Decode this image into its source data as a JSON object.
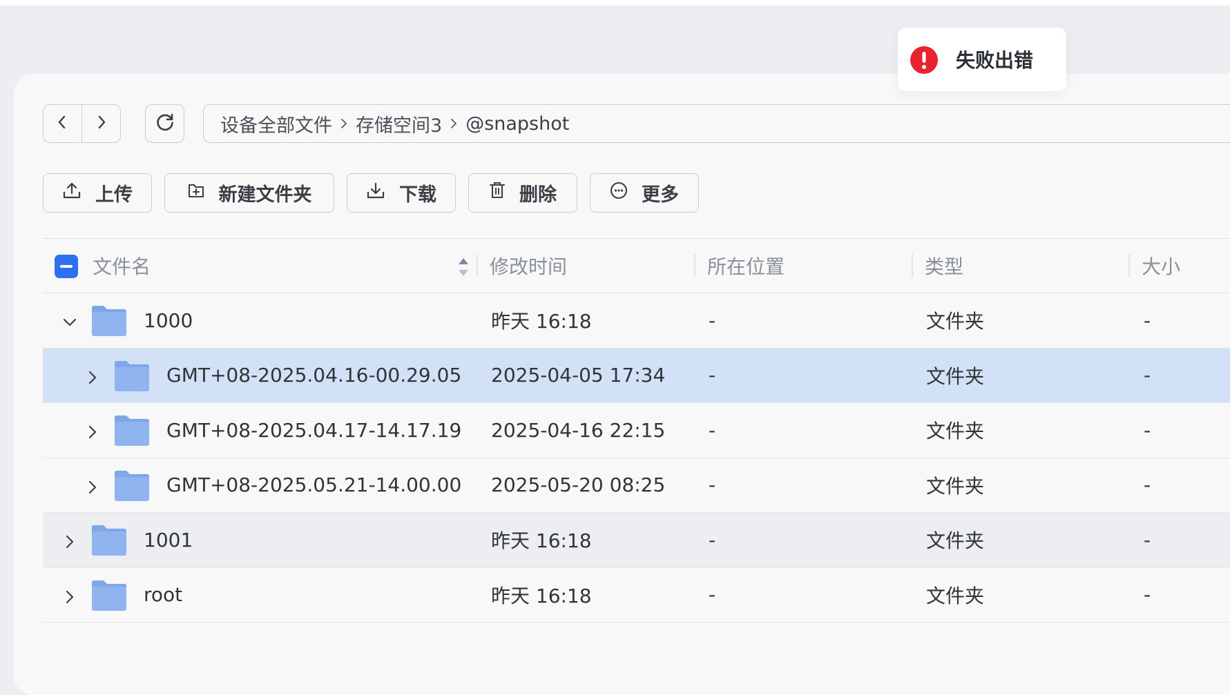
{
  "colors": {
    "accent": "#2d6ff0",
    "error": "#e8232f",
    "selected_row": "#d3e1f6",
    "folder_body": "#8fb4ef",
    "folder_tab": "#7ea7e8"
  },
  "toast": {
    "icon": "error-exclamation-icon",
    "message": "失败出错"
  },
  "nav": {
    "back_icon": "chevron-left-icon",
    "forward_icon": "chevron-right-icon",
    "refresh_icon": "refresh-icon"
  },
  "breadcrumb": [
    "设备全部文件",
    "存储空间3",
    "@snapshot"
  ],
  "toolbar": {
    "upload": "上传",
    "new_folder": "新建文件夹",
    "download": "下载",
    "delete": "删除",
    "more": "更多"
  },
  "table": {
    "headers": {
      "name": "文件名",
      "modified": "修改时间",
      "location": "所在位置",
      "type": "类型",
      "size": "大小"
    },
    "rows": [
      {
        "name": "1000",
        "modified": "昨天 16:18",
        "location": "-",
        "type": "文件夹",
        "size": "-",
        "level": 0,
        "expanded": true
      },
      {
        "name": "GMT+08-2025.04.16-00.29.05",
        "modified": "2025-04-05 17:34",
        "location": "-",
        "type": "文件夹",
        "size": "-",
        "level": 1,
        "expanded": false,
        "selected": true
      },
      {
        "name": "GMT+08-2025.04.17-14.17.19",
        "modified": "2025-04-16 22:15",
        "location": "-",
        "type": "文件夹",
        "size": "-",
        "level": 1,
        "expanded": false
      },
      {
        "name": "GMT+08-2025.05.21-14.00.00",
        "modified": "2025-05-20 08:25",
        "location": "-",
        "type": "文件夹",
        "size": "-",
        "level": 1,
        "expanded": false
      },
      {
        "name": "1001",
        "modified": "昨天 16:18",
        "location": "-",
        "type": "文件夹",
        "size": "-",
        "level": 0,
        "expanded": false,
        "hover": true
      },
      {
        "name": "root",
        "modified": "昨天 16:18",
        "location": "-",
        "type": "文件夹",
        "size": "-",
        "level": 0,
        "expanded": false
      }
    ]
  }
}
